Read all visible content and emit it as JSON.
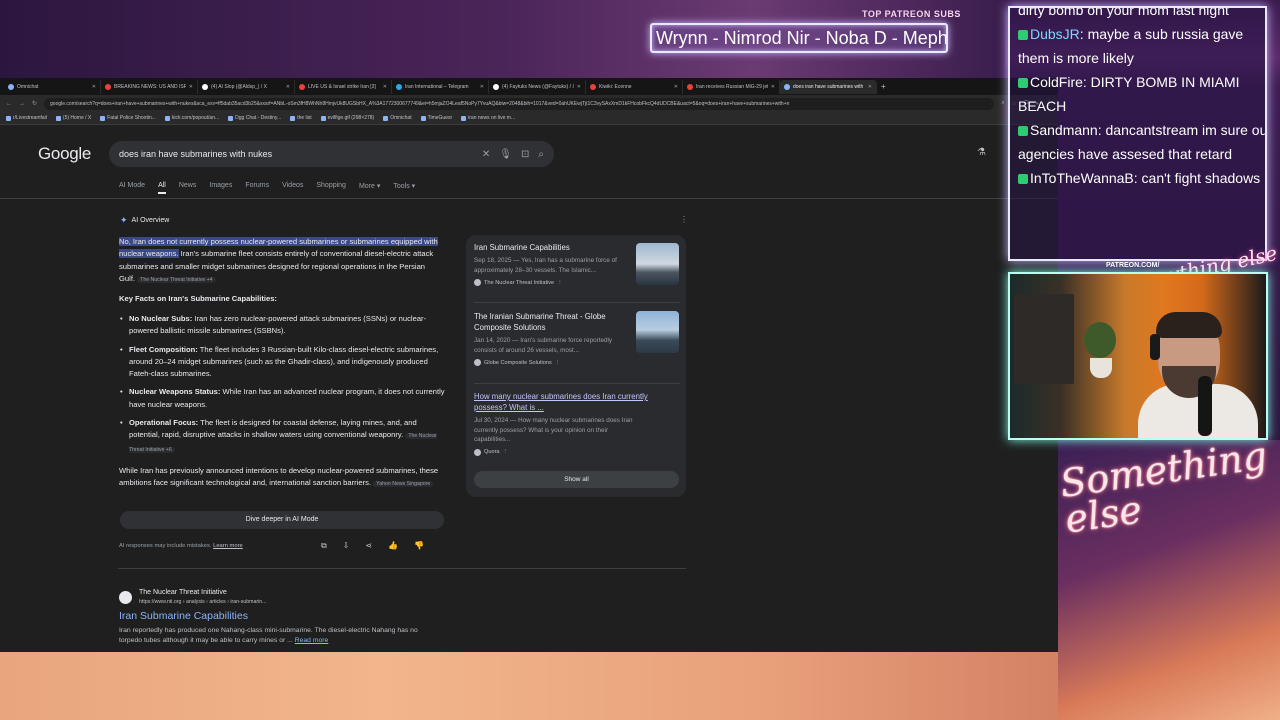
{
  "overlay": {
    "patreon_label": "TOP PATREON SUBS",
    "patreon_names": "Wrynn - Nimrod Nir - Noba D - Mephe",
    "patreon_url": "PATREON.COM/",
    "signature_main": "Something else",
    "signature_small": "Anything else"
  },
  "tabs": [
    {
      "label": "Omnichat",
      "color": "#8ab4f8"
    },
    {
      "label": "BREAKING NEWS: US AND ISRAEL",
      "color": "#ea4335"
    },
    {
      "label": "(4) AI Slop (@Aldsp_) / X",
      "color": "#ffffff"
    },
    {
      "label": "LIVE US & Israel strike Iran [3]",
      "color": "#ea4335"
    },
    {
      "label": "Iran International – Telegram",
      "color": "#29a9eb"
    },
    {
      "label": "(4) Faytuks News (@Faytuks) / X",
      "color": "#ffffff"
    },
    {
      "label": "Kiwiki: Ecenne",
      "color": "#ea4335"
    },
    {
      "label": "Iran receives Russian MiG-29 jets",
      "color": "#ea4335"
    },
    {
      "label": "does iran have submarines with",
      "color": "#8ab4f8"
    }
  ],
  "address": {
    "url": "google.com/search?q=does+iran+have+submarines+with+nukes&sca_esv=ff5dab35acd3b25&sxsrf=ANbL-oSm3fH8WhNh8HmjvUk8UGSbHX_A%3A1772300677749&ei=h5mjaZO4Leaf5NoPy7YvuAQ&biw=2048&bih=1017&ved=0ahUKEwjTjt1C3vySAxXmD1kFHcobFkcQ4dUDCBE&uact=5&oq=does+iran+have+submarines+with+n"
  },
  "bookmarks": [
    "r/Livestreamfail",
    "(5) Home / X",
    "Fatal Police Shootin...",
    "kick.com/popout/an...",
    "Dgg Chat - Destiny...",
    "the list",
    "evilfige.gif (298×278)",
    "Omnichat",
    "TimeGuesr",
    "iran news on live m..."
  ],
  "google": {
    "logo": "Google",
    "query": "does iran have submarines with nukes",
    "nav_tabs": [
      "AI Mode",
      "All",
      "News",
      "Images",
      "Forums",
      "Videos",
      "Shopping",
      "More ▾",
      "Tools ▾"
    ],
    "active_tab": "All"
  },
  "ai_overview": {
    "heading": "AI Overview",
    "lead_highlight": "No, Iran does not currently possess nuclear-powered submarines or submarines equipped with nuclear weapons.",
    "lead_rest": " Iran's submarine fleet consists entirely of conventional diesel-electric attack submarines and smaller midget submarines designed for regional operations in the Persian Gulf.",
    "lead_chip": "The Nuclear Threat Initiative +4",
    "key_heading": "Key Facts on Iran's Submarine Capabilities:",
    "bullets": [
      {
        "bold": "No Nuclear Subs:",
        "text": " Iran has zero nuclear-powered attack submarines (SSNs) or nuclear-powered ballistic missile submarines (SSBNs).",
        "chip": ""
      },
      {
        "bold": "Fleet Composition:",
        "text": " The fleet includes 3 Russian-built Kilo-class diesel-electric submarines, around 20–24 midget submarines (such as the Ghadir-class), and indigenously produced Fateh-class submarines.",
        "chip": ""
      },
      {
        "bold": "Nuclear Weapons Status:",
        "text": " While Iran has an advanced nuclear program, it does not currently have nuclear weapons.",
        "chip": ""
      },
      {
        "bold": "Operational Focus:",
        "text": " The fleet is designed for coastal defense, laying mines, and, and potential, rapid, disruptive attacks in shallow waters using conventional weaponry.",
        "chip": "The Nuclear Threat Initiative +6"
      }
    ],
    "closing": "While Iran has previously announced intentions to develop nuclear-powered submarines, these ambitions face significant technological and, international sanction barriers.",
    "closing_chip": "Yahoo News Singapore",
    "dive_button": "Dive deeper in AI Mode",
    "disclaimer": "AI responses may include mistakes.",
    "learn_more": "Learn more"
  },
  "sources": [
    {
      "title": "Iran Submarine Capabilities",
      "date_snippet": "Sep 18, 2025 — Yes, Iran has a submarine force of approximately 28–30 vessels. The Islamic...",
      "origin": "The Nuclear Threat Initiative",
      "link": false
    },
    {
      "title": "The Iranian Submarine Threat - Globe Composite Solutions",
      "date_snippet": "Jan 14, 2020 — Iran's submarine force reportedly consists of around 26 vessels, most...",
      "origin": "Globe Composite Solutions",
      "link": false
    },
    {
      "title": "How many nuclear submarines does Iran currently possess? What is ...",
      "date_snippet": "Jul 30, 2024 — How many nuclear submarines does Iran currently possess? What is your opinion on their capabilities...",
      "origin": "Quora",
      "link": true
    }
  ],
  "show_all": "Show all",
  "result": {
    "site": "The Nuclear Threat Initiative",
    "url": "https://www.nti.org › analysis › articles › iran-submarin...",
    "title": "Iran Submarine Capabilities",
    "snippet": "Iran reportedly has produced one Nahang-class mini-submarine. The diesel-electric Nahang has no torpedo tubes although it may be able to carry mines or ...",
    "read_more": "Read more"
  },
  "chat": [
    {
      "user": "",
      "text": "dirty bomb on your mom last night",
      "color": "#ffffff"
    },
    {
      "user": "DubsJR",
      "text": ": maybe a sub russia gave them is more likely",
      "color": "#7fd6ff"
    },
    {
      "user": "ColdFire",
      "text": ": DIRTY BOMB IN MIAMI BEACH",
      "color": "#ffffff"
    },
    {
      "user": "Sandmann",
      "text": ": dancantstream im sure our agencies have assesed that retard",
      "color": "#ffffff"
    },
    {
      "user": "InToTheWannaB",
      "text": ": can't fight shadows",
      "color": "#ffffff"
    }
  ],
  "colors": {
    "accent_link": "#8ab4f8",
    "highlight": "#3b4a86",
    "chat_border": "#e9e9ff",
    "cam_border": "#b8fff2"
  }
}
